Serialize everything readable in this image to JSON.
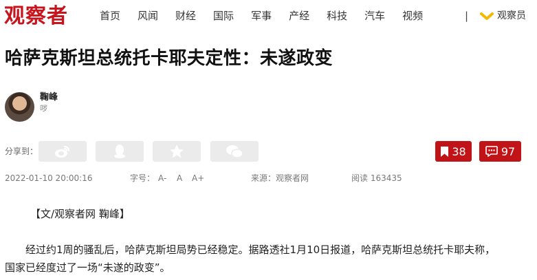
{
  "header": {
    "logo": "观察者",
    "nav": [
      "首页",
      "风闻",
      "财经",
      "国际",
      "军事",
      "产经",
      "科技",
      "汽车",
      "视频"
    ],
    "separator": "|",
    "member_label": "观察员"
  },
  "article": {
    "title": "哈萨克斯坦总统托卡耶夫定性：未遂政变",
    "author_name": "鞠峰",
    "author_desc": "哕",
    "share_label": "分享到：",
    "bookmark_count": "38",
    "comment_count": "97",
    "date": "2022-01-10 20:00:16",
    "font_size_label": "字号：",
    "font_sizes": [
      "A-",
      "A",
      "A+"
    ],
    "source": "来源：观察者网",
    "reads": "阅读 163435",
    "paragraphs": [
      "【文/观察者网 鞠峰】",
      "经过约1周的骚乱后，哈萨克斯坦局势已经稳定。据路透社1月10日报道，哈萨克斯坦总统托卡耶夫称，",
      "国家已经度过了一场“未遂的政变”。"
    ]
  },
  "colors": {
    "brand": "#c8141c",
    "member_accent": "#f5b800",
    "share_bg": "#ebebeb"
  },
  "icons": [
    "weibo-icon",
    "qq-icon",
    "qzone-star-icon",
    "wechat-icon",
    "bookmark-icon",
    "comment-icon",
    "check-chevron-icon"
  ]
}
